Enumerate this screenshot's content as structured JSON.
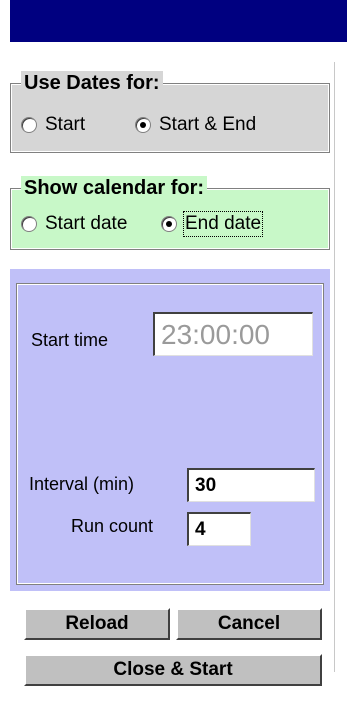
{
  "window": {
    "title": ""
  },
  "use_dates": {
    "legend": "Use Dates for:",
    "options": [
      {
        "label": "Start",
        "selected": false
      },
      {
        "label": "Start & End",
        "selected": true
      }
    ]
  },
  "show_calendar": {
    "legend": "Show calendar for:",
    "options": [
      {
        "label": "Start date",
        "selected": false
      },
      {
        "label": "End date",
        "selected": true
      }
    ]
  },
  "schedule": {
    "start_time_label": "Start time",
    "start_time_value": "23:00:00",
    "interval_label": "Interval (min)",
    "interval_value": "30",
    "run_count_label": "Run count",
    "run_count_value": "4"
  },
  "buttons": {
    "reload": "Reload",
    "cancel": "Cancel",
    "close_start": "Close & Start"
  },
  "colors": {
    "title_bar": "#000080",
    "use_dates_bg": "#d6d6d6",
    "show_calendar_bg": "#c8f8c8",
    "schedule_bg": "#c0c0f8",
    "button_face": "#c0c0c0",
    "disabled_text": "#9a9a9a"
  }
}
